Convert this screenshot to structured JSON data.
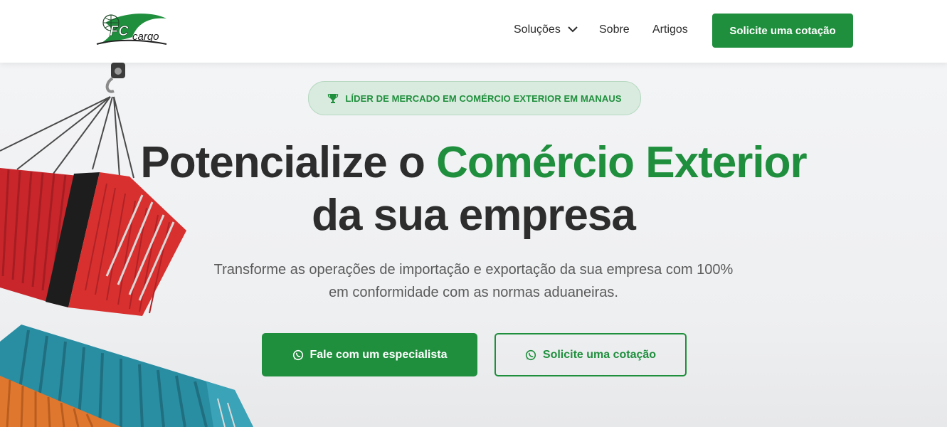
{
  "header": {
    "logo_text": "FC cargo",
    "nav": {
      "solucoes": "Soluções",
      "sobre": "Sobre",
      "artigos": "Artigos"
    },
    "cta": "Solicite uma cotação"
  },
  "hero": {
    "badge": "LÍDER DE MERCADO EM COMÉRCIO EXTERIOR EM MANAUS",
    "title_part1": "Potencialize o ",
    "title_highlight": "Comércio Exterior",
    "title_line2": "da sua empresa",
    "subtitle_line1": "Transforme as operações de importação e exportação da sua empresa com 100%",
    "subtitle_line2": "em conformidade com as normas aduaneiras.",
    "primary_button": "Fale com um especialista",
    "secondary_button": "Solicite uma cotação"
  },
  "colors": {
    "brand_green": "#1f8f3d",
    "text_dark": "#2d2d2d",
    "background": "#f1f2f4"
  },
  "icons": {
    "badge": "trophy-icon",
    "buttons": "whatsapp-icon",
    "nav_dropdown": "chevron-down-icon"
  }
}
